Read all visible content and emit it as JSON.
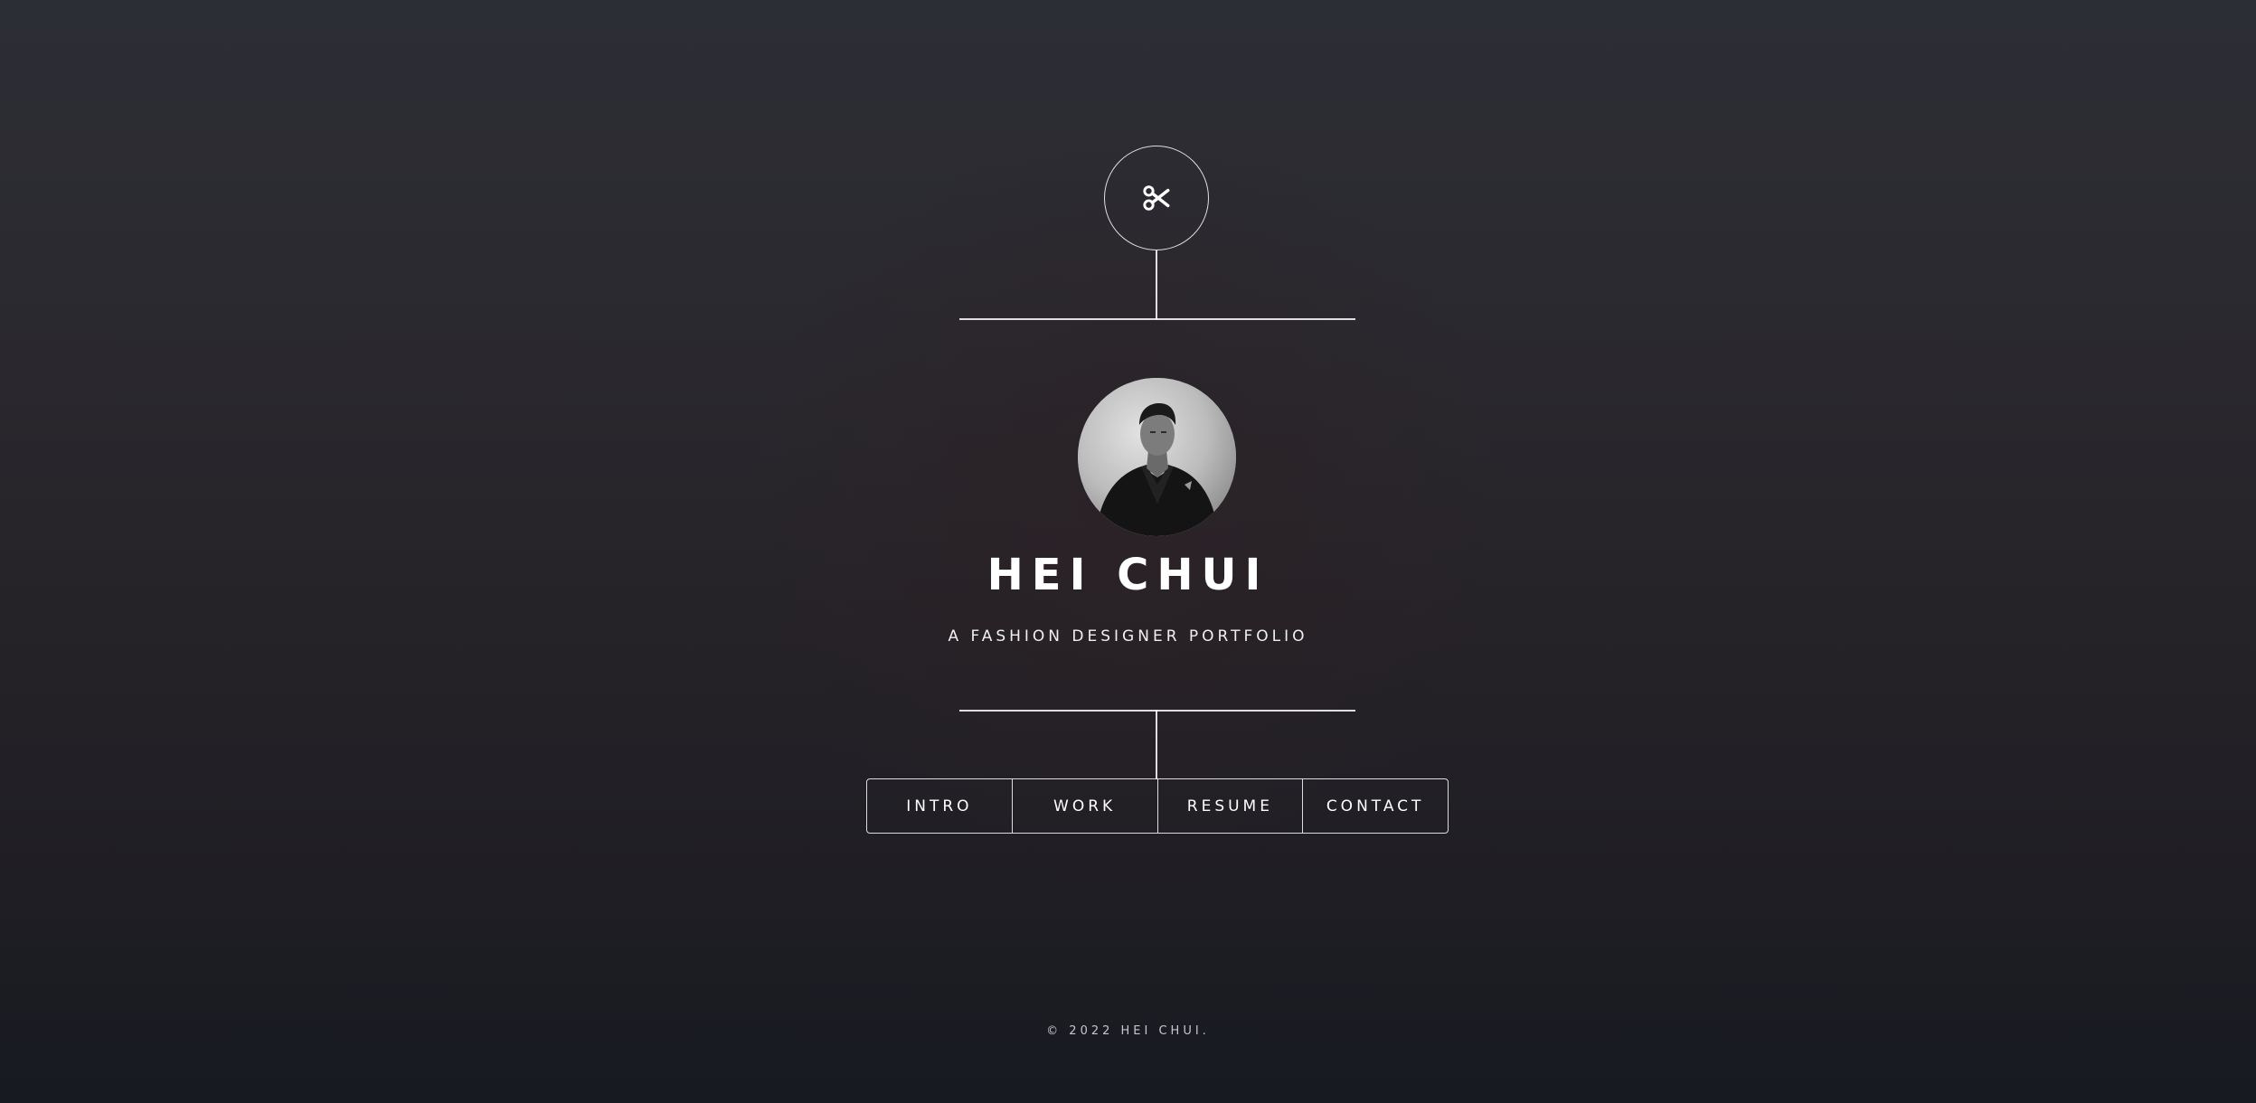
{
  "header": {
    "logo_icon": "scissors-icon"
  },
  "profile": {
    "name": "HEI CHUI",
    "tagline": "A FASHION DESIGNER PORTFOLIO",
    "avatar": "portrait-photo"
  },
  "nav": {
    "items": [
      {
        "label": "INTRO"
      },
      {
        "label": "WORK"
      },
      {
        "label": "RESUME"
      },
      {
        "label": "CONTACT"
      }
    ]
  },
  "footer": {
    "copyright": "© 2022 HEI CHUI."
  },
  "colors": {
    "text": "#ffffff",
    "line": "#d9d9d9",
    "background_top": "#2c2e35",
    "background_bottom": "#171a21"
  }
}
